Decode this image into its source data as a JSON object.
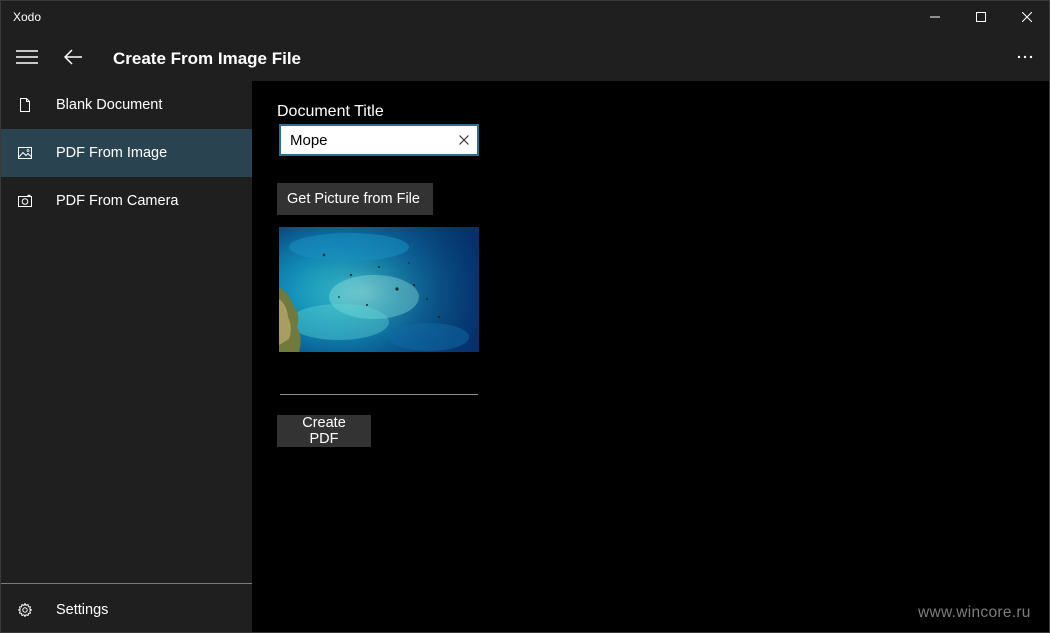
{
  "window": {
    "app_name": "Xodo"
  },
  "header": {
    "title": "Create From Image File"
  },
  "sidebar": {
    "items": [
      {
        "label": "Blank Document",
        "icon": "document-icon"
      },
      {
        "label": "PDF From Image",
        "icon": "image-icon",
        "active": true
      },
      {
        "label": "PDF From Camera",
        "icon": "camera-icon"
      }
    ],
    "settings_label": "Settings"
  },
  "content": {
    "doc_title_label": "Document Title",
    "doc_title_value": "Mope",
    "get_picture_label": "Get Picture from File",
    "create_pdf_label": "Create PDF"
  },
  "watermark": "www.wincore.ru",
  "colors": {
    "chrome": "#1f1f1f",
    "active_nav": "#294450",
    "button": "#333333",
    "input_border": "#2a6f8f",
    "content_bg": "#000000"
  }
}
